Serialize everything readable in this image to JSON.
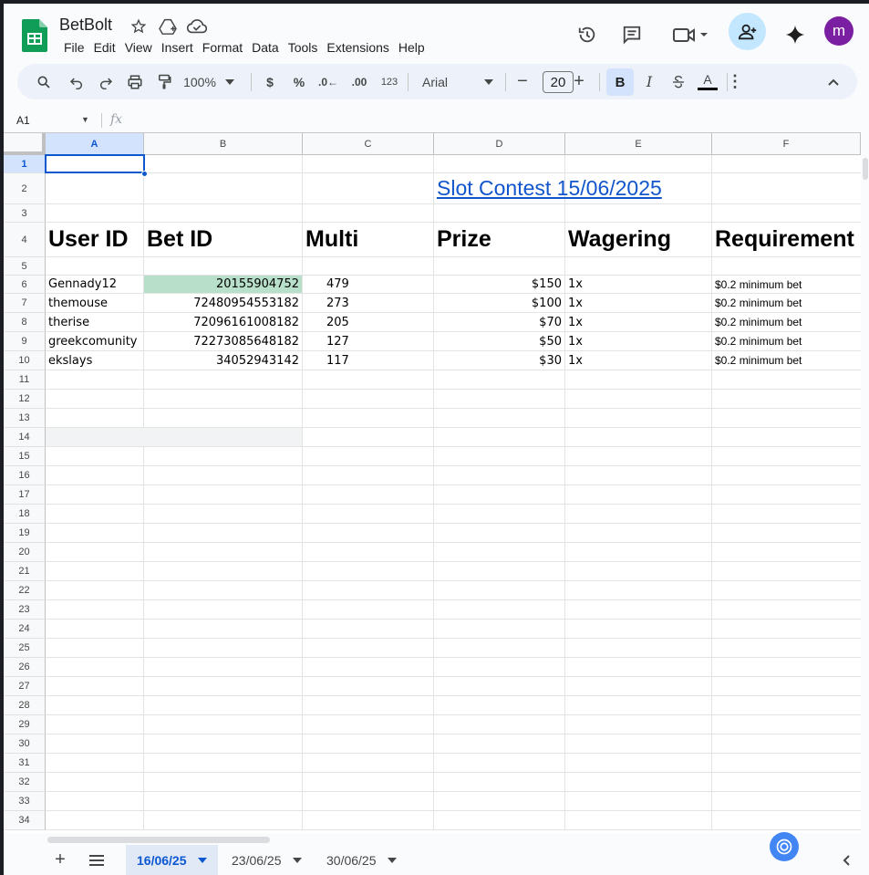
{
  "app": {
    "doc_title": "BetBolt",
    "menu": [
      "File",
      "Edit",
      "View",
      "Insert",
      "Format",
      "Data",
      "Tools",
      "Extensions",
      "Help"
    ],
    "avatar_initial": "m",
    "accent_color": "#0b57d0",
    "logo_color": "#0f9d58",
    "avatar_color": "#7b1fa2"
  },
  "toolbar": {
    "zoom": "100%",
    "currency": "$",
    "percent": "%",
    "decrease_decimals": ".0←",
    "increase_decimals": ".00",
    "number_format": "123",
    "font": "Arial",
    "font_size": "20",
    "bold": "B",
    "italic": "I",
    "text_color": "A"
  },
  "formula_bar": {
    "name_box": "A1",
    "fx": "fx",
    "content": ""
  },
  "grid": {
    "columns": [
      "A",
      "B",
      "C",
      "D",
      "E",
      "F"
    ],
    "selected_column": "A",
    "rows": [
      "1",
      "2",
      "3",
      "4",
      "5",
      "6",
      "7",
      "8",
      "9",
      "10",
      "11",
      "12",
      "13",
      "14",
      "15",
      "16",
      "17",
      "18",
      "19",
      "20",
      "21",
      "22",
      "23",
      "24",
      "25",
      "26",
      "27",
      "28",
      "29",
      "30",
      "31",
      "32",
      "33",
      "34"
    ],
    "selected_row": "1",
    "title_link": "Slot Contest 15/06/2025",
    "headers": [
      "User ID",
      "Bet ID",
      "Multi",
      "Prize",
      "Wagering",
      "Requirement"
    ],
    "data": [
      {
        "user": "Gennady12",
        "bet": "20155904752",
        "multi": "479",
        "prize": "$150",
        "wager": "1x",
        "req": "$0.2 minimum bet"
      },
      {
        "user": "themouse",
        "bet": "72480954553182",
        "multi": "273",
        "prize": "$100",
        "wager": "1x",
        "req": "$0.2 minimum bet"
      },
      {
        "user": "therise",
        "bet": "72096161008182",
        "multi": "205",
        "prize": "$70",
        "wager": "1x",
        "req": "$0.2 minimum bet"
      },
      {
        "user": "greekcomunity",
        "bet": "72273085648182",
        "multi": "127",
        "prize": "$50",
        "wager": "1x",
        "req": "$0.2 minimum bet"
      },
      {
        "user": "ekslays",
        "bet": "34052943142",
        "multi": "117",
        "prize": "$30",
        "wager": "1x",
        "req": "$0.2 minimum bet"
      }
    ],
    "highlight_color": "#b7dfc9",
    "link_color": "#1155cc"
  },
  "sheets": {
    "tabs": [
      "16/06/25",
      "23/06/25",
      "30/06/25"
    ],
    "active": "16/06/25"
  }
}
